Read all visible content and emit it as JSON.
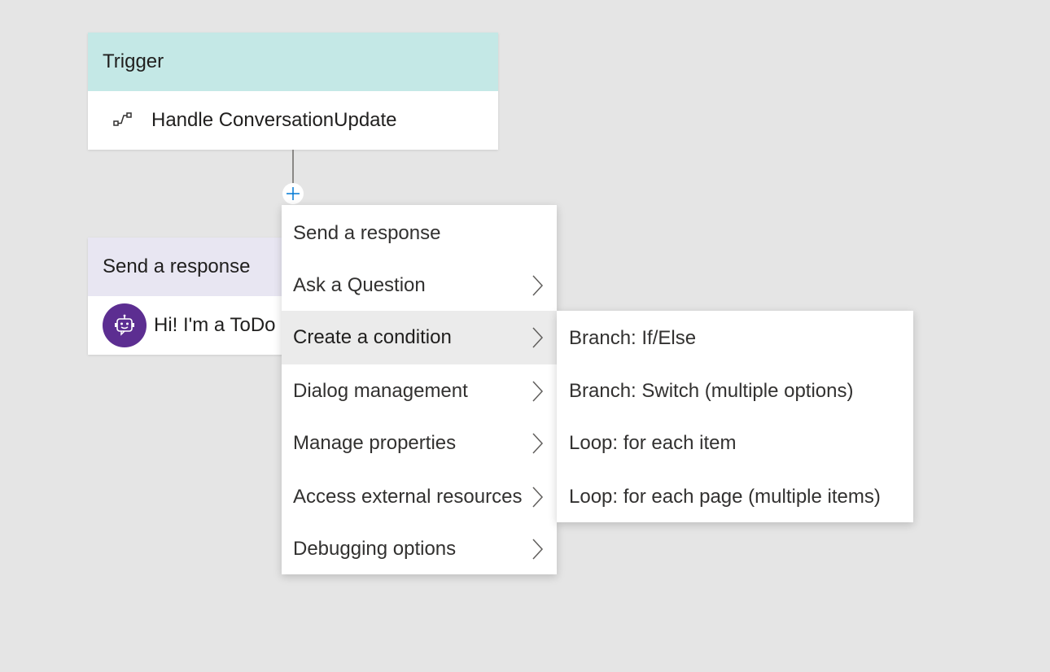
{
  "trigger_node": {
    "header": "Trigger",
    "label": "Handle ConversationUpdate",
    "icon": "trigger-flow-icon"
  },
  "response_node": {
    "header": "Send a response",
    "text": "Hi! I'm a ToDo",
    "icon": "bot-icon"
  },
  "add_button": {
    "icon": "plus-icon"
  },
  "menu": {
    "items": [
      {
        "label": "Send a response",
        "has_submenu": false
      },
      {
        "label": "Ask a Question",
        "has_submenu": true
      },
      {
        "label": "Create a condition",
        "has_submenu": true,
        "active": true
      },
      {
        "label": "Dialog management",
        "has_submenu": true
      },
      {
        "label": "Manage properties",
        "has_submenu": true
      },
      {
        "label": "Access external resources",
        "has_submenu": true
      },
      {
        "label": "Debugging options",
        "has_submenu": true
      }
    ]
  },
  "submenu": {
    "items": [
      {
        "label": "Branch: If/Else"
      },
      {
        "label": "Branch: Switch (multiple options)"
      },
      {
        "label": "Loop: for each item"
      },
      {
        "label": "Loop: for each page (multiple items)"
      }
    ]
  },
  "colors": {
    "canvas": "#e5e5e5",
    "trigger_header": "#c4e8e6",
    "response_header": "#e8e6f2",
    "bot_avatar": "#5c2e91",
    "accent": "#0078d4",
    "menu_active": "#ebebeb"
  }
}
